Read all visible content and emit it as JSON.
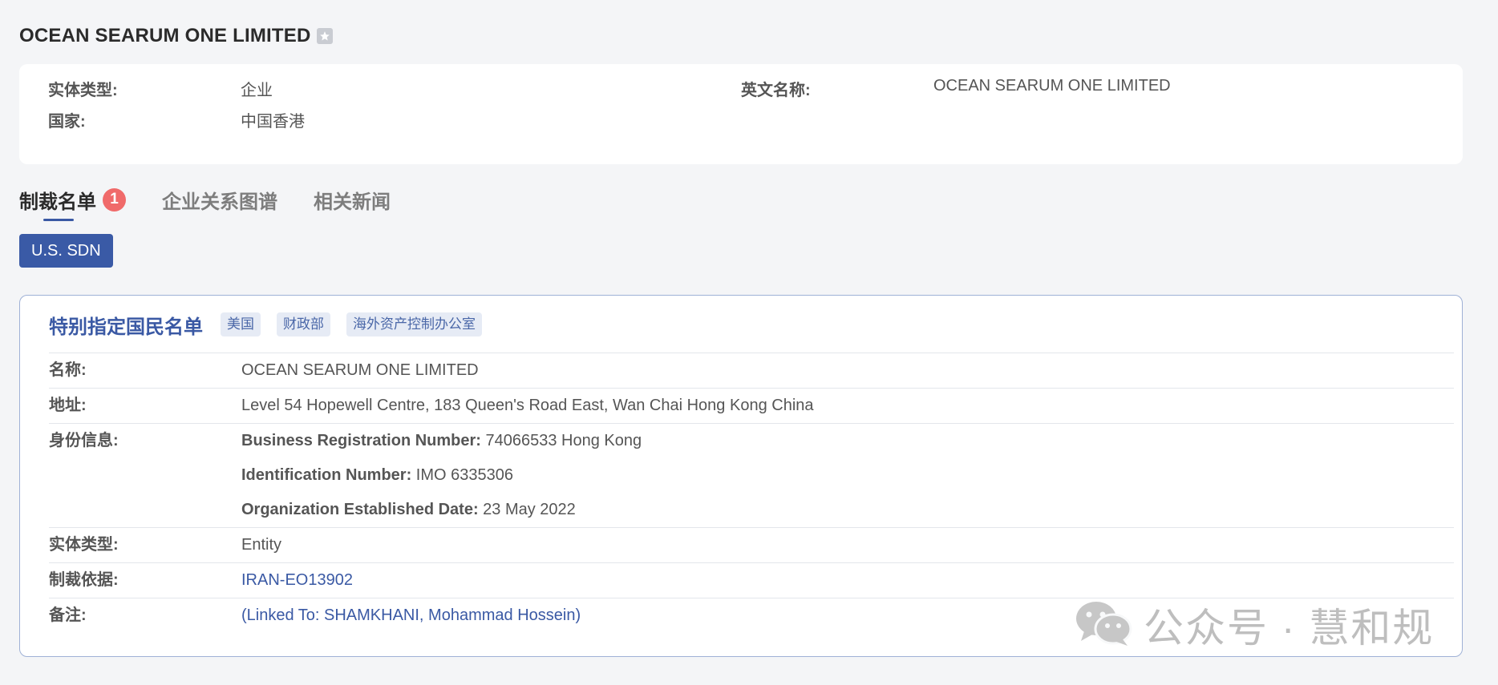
{
  "header": {
    "title": "OCEAN SEARUM ONE LIMITED",
    "favorite_icon": "star-icon"
  },
  "info": {
    "entity_type_label": "实体类型:",
    "entity_type_value": "企业",
    "country_label": "国家:",
    "country_value": "中国香港",
    "english_name_label": "英文名称:",
    "english_name_value": "OCEAN SEARUM ONE LIMITED"
  },
  "tabs": [
    {
      "label": "制裁名单",
      "badge": "1",
      "active": true
    },
    {
      "label": "企业关系图谱",
      "active": false
    },
    {
      "label": "相关新闻",
      "active": false
    }
  ],
  "list_button": {
    "label": "U.S. SDN"
  },
  "detail": {
    "title": "特别指定国民名单",
    "tags": [
      "美国",
      "财政部",
      "海外资产控制办公室"
    ],
    "rows": {
      "name_label": "名称:",
      "name_value": "OCEAN SEARUM ONE LIMITED",
      "address_label": "地址:",
      "address_value": "Level 54 Hopewell Centre, 183 Queen's Road East, Wan Chai Hong Kong China",
      "identity_label": "身份信息:",
      "identity": [
        {
          "label": "Business Registration Number:",
          "value": " 74066533 Hong Kong"
        },
        {
          "label": "Identification Number:",
          "value": " IMO 6335306"
        },
        {
          "label": "Organization Established Date:",
          "value": " 23 May 2022"
        }
      ],
      "entity_type_label": "实体类型:",
      "entity_type_value": "Entity",
      "basis_label": "制裁依据:",
      "basis_value": "IRAN-EO13902",
      "remark_label": "备注:",
      "remark_value": "(Linked To: SHAMKHANI, Mohammad Hossein)"
    }
  },
  "watermark": {
    "text": "公众号 · 慧和规",
    "icon": "wechat-icon"
  },
  "colors": {
    "accent": "#3a59a4",
    "badge": "#f06a6a",
    "background": "#f4f5f7"
  }
}
